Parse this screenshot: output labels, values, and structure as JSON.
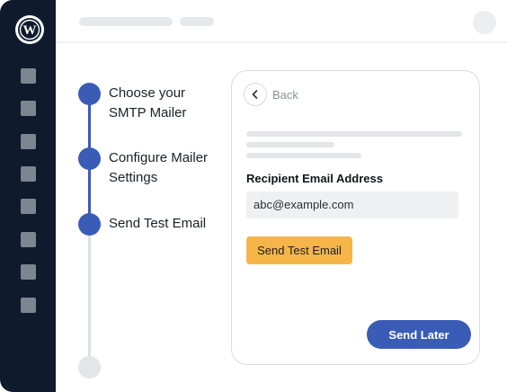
{
  "sidebar": {
    "logo_icon": "wordpress-icon",
    "items": [
      {
        "icon": "menu-item-1"
      },
      {
        "icon": "menu-item-2"
      },
      {
        "icon": "menu-item-3"
      },
      {
        "icon": "menu-item-4"
      },
      {
        "icon": "menu-item-5"
      },
      {
        "icon": "menu-item-6"
      },
      {
        "icon": "menu-item-7"
      },
      {
        "icon": "menu-item-8"
      }
    ]
  },
  "steps": [
    {
      "label": "Choose your SMTP Mailer",
      "state": "done"
    },
    {
      "label": "Configure Mailer Settings",
      "state": "done"
    },
    {
      "label": "Send Test Email",
      "state": "current"
    },
    {
      "label": "",
      "state": "pending"
    }
  ],
  "card": {
    "back_label": "Back",
    "recipient_label": "Recipient Email Address",
    "recipient_value": "abc@example.com",
    "send_test_label": "Send Test Email",
    "send_later_label": "Send Later"
  },
  "colors": {
    "sidebar_bg": "#0f1b2d",
    "accent_blue": "#3a5cb7",
    "accent_orange": "#f5b548"
  }
}
